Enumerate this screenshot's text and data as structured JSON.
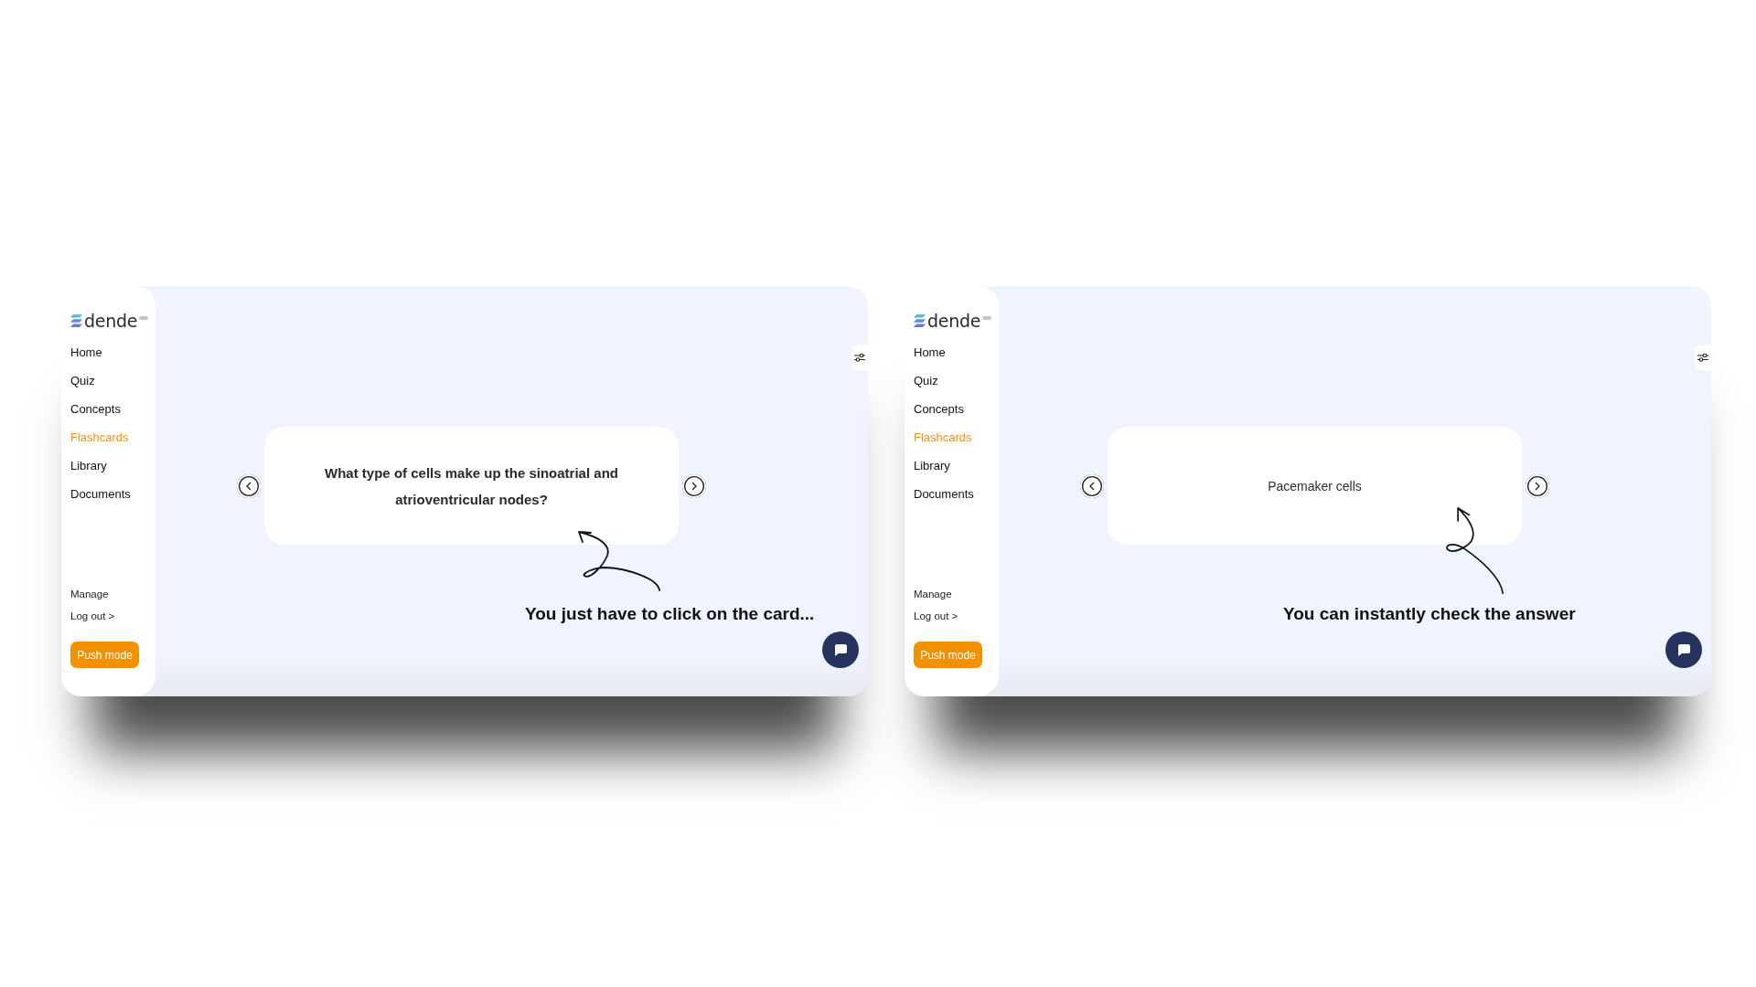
{
  "panels": [
    {
      "sidebar": {
        "logo": "dende",
        "nav": [
          {
            "label": "Home",
            "selected": false
          },
          {
            "label": "Quiz",
            "selected": false
          },
          {
            "label": "Concepts",
            "selected": false
          },
          {
            "label": "Flashcards",
            "selected": true
          },
          {
            "label": "Library",
            "selected": false
          },
          {
            "label": "Documents",
            "selected": false
          }
        ],
        "footer_links": [
          "Manage",
          "Log out >"
        ],
        "push_button": "Push mode"
      },
      "flashcard": {
        "kind": "question",
        "text": "What type of cells make up the sinoatrial and atrioventricular nodes?"
      },
      "annotation": "You just have to click on the card..."
    },
    {
      "sidebar": {
        "logo": "dende",
        "nav": [
          {
            "label": "Home",
            "selected": false
          },
          {
            "label": "Quiz",
            "selected": false
          },
          {
            "label": "Concepts",
            "selected": false
          },
          {
            "label": "Flashcards",
            "selected": true
          },
          {
            "label": "Library",
            "selected": false
          },
          {
            "label": "Documents",
            "selected": false
          }
        ],
        "footer_links": [
          "Manage",
          "Log out >"
        ],
        "push_button": "Push mode"
      },
      "flashcard": {
        "kind": "answer",
        "text": "Pacemaker cells"
      },
      "annotation": "You can instantly check the answer"
    }
  ]
}
